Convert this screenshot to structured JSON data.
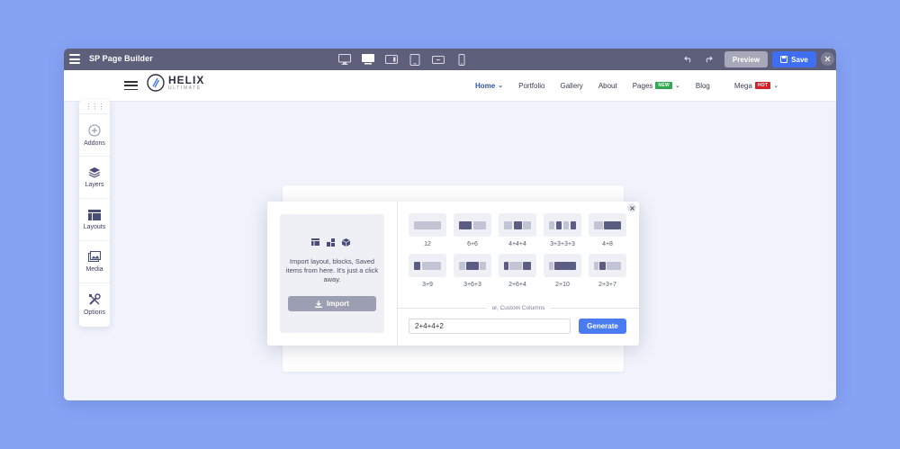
{
  "app": {
    "title": "SP Page Builder"
  },
  "toolbar": {
    "devices": [
      "desktop-large-icon",
      "desktop-icon",
      "laptop-icon",
      "tablet-icon",
      "tablet-landscape-icon",
      "mobile-icon"
    ],
    "active_device": 1,
    "preview_label": "Preview",
    "save_label": "Save"
  },
  "site": {
    "logo_main": "HELIX",
    "logo_sub": "ULTIMATE",
    "nav": [
      {
        "label": "Home",
        "active": true,
        "dropdown": true
      },
      {
        "label": "Portfolio"
      },
      {
        "label": "Gallery"
      },
      {
        "label": "About"
      },
      {
        "label": "Pages",
        "badge": "NEW",
        "badge_color": "#2fa84f",
        "dropdown": true
      },
      {
        "label": "Blog"
      },
      {
        "label": "Mega",
        "badge": "HOT",
        "badge_color": "#d32027",
        "dropdown": true
      }
    ]
  },
  "sidebar": {
    "items": [
      {
        "label": "Addons",
        "icon": "plus-circle-icon"
      },
      {
        "label": "Layers",
        "icon": "layers-icon"
      },
      {
        "label": "Layouts",
        "icon": "layout-icon"
      },
      {
        "label": "Media",
        "icon": "media-icon"
      },
      {
        "label": "Options",
        "icon": "tools-icon"
      }
    ]
  },
  "modal": {
    "import_text": "Import layout, blocks, Saved items from here. It's just a click away.",
    "import_label": "Import",
    "layouts": [
      {
        "label": "12",
        "cols": [
          12
        ]
      },
      {
        "label": "6+6",
        "cols": [
          6,
          6
        ]
      },
      {
        "label": "4+4+4",
        "cols": [
          4,
          4,
          4
        ]
      },
      {
        "label": "3+3+3+3",
        "cols": [
          3,
          3,
          3,
          3
        ]
      },
      {
        "label": "4+8",
        "cols": [
          4,
          8
        ]
      },
      {
        "label": "3+9",
        "cols": [
          3,
          9
        ]
      },
      {
        "label": "3+6+3",
        "cols": [
          3,
          6,
          3
        ]
      },
      {
        "label": "2+6+4",
        "cols": [
          2,
          6,
          4
        ]
      },
      {
        "label": "2+10",
        "cols": [
          2,
          10
        ]
      },
      {
        "label": "2+3+7",
        "cols": [
          2,
          3,
          7
        ]
      }
    ],
    "custom_label": "or, Custom Columns",
    "custom_value": "2+4+4+2",
    "generate_label": "Generate"
  },
  "colors": {
    "accent": "#3f6ff0",
    "toolbar": "#5d5f7b",
    "background": "#86a2f3"
  }
}
